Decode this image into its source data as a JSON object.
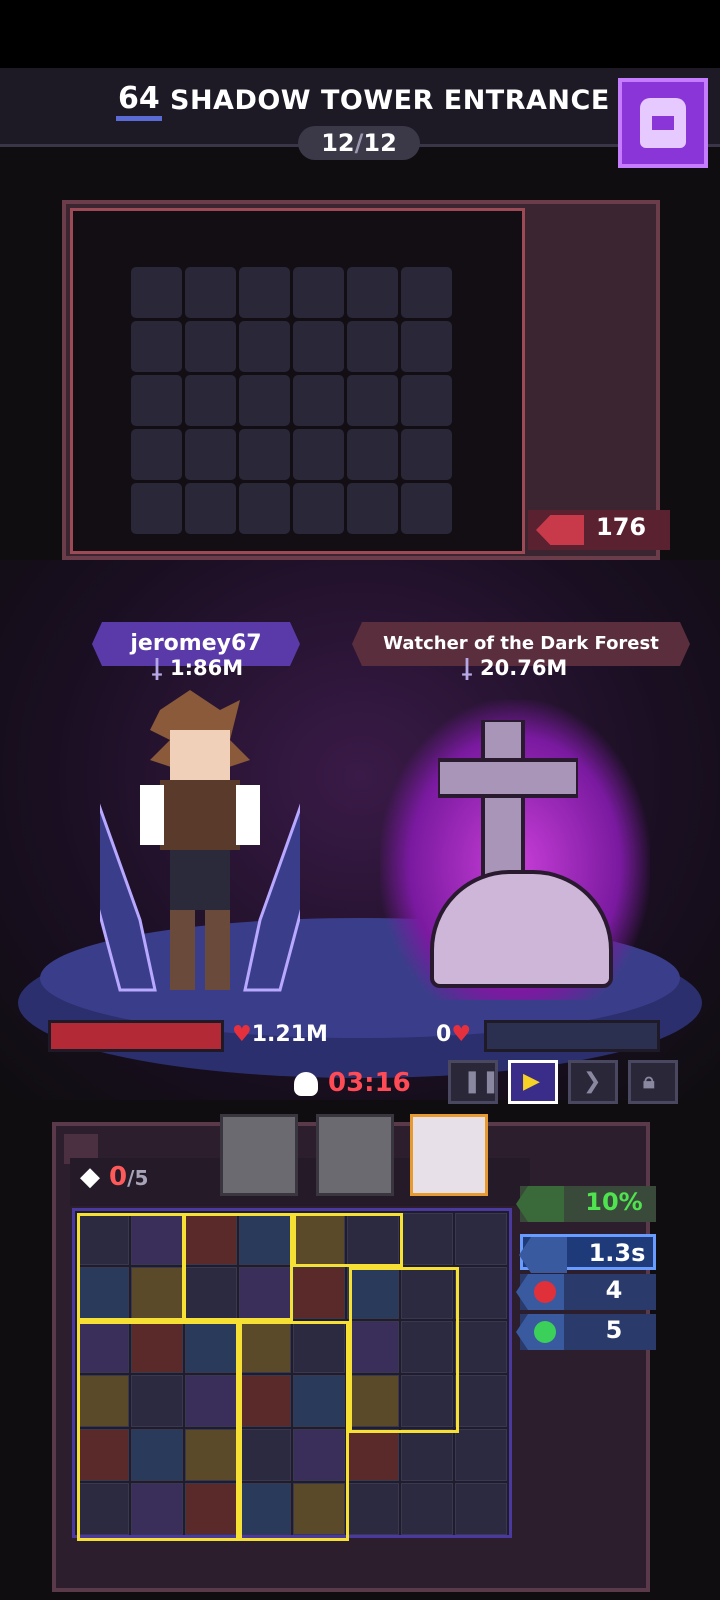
{
  "header": {
    "floor_level": "64",
    "title": "SHADOW TOWER ENTRANCE",
    "stage_current": "12",
    "stage_sep": "/",
    "stage_total": "12"
  },
  "loot": {
    "gold_count": "176"
  },
  "player": {
    "name": "jeromey67",
    "power": "1:86M",
    "hp_text": "1.21M"
  },
  "enemy": {
    "name": "Watcher of the Dark Forest",
    "power": "20.76M",
    "hp_text": "0"
  },
  "battle": {
    "timer": "03:16",
    "controls": [
      "pause",
      "play",
      "fast-forward",
      "locked"
    ]
  },
  "inventory": {
    "gem_current": "0",
    "gem_max": "/5",
    "stats": [
      {
        "name": "heal",
        "value": "10%"
      },
      {
        "name": "attack-speed",
        "value": "1.3s"
      },
      {
        "name": "damage",
        "value": "4"
      },
      {
        "name": "regen",
        "value": "5"
      }
    ]
  },
  "colors": {
    "accent_purple": "#8a35d8",
    "hp_red": "#b32a36",
    "timer_red": "#ff4b55",
    "highlight_yellow": "#f5e033"
  }
}
